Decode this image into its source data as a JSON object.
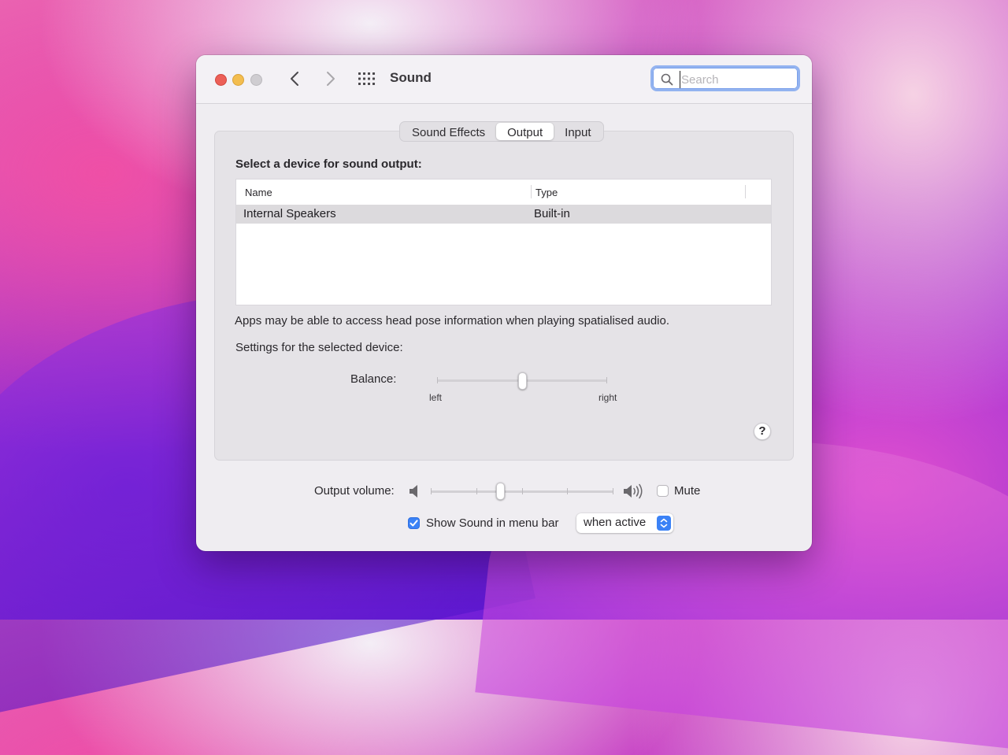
{
  "window": {
    "title": "Sound"
  },
  "search": {
    "placeholder": "Search",
    "value": ""
  },
  "tabs": [
    {
      "label": "Sound Effects",
      "active": false
    },
    {
      "label": "Output",
      "active": true
    },
    {
      "label": "Input",
      "active": false
    }
  ],
  "output": {
    "heading": "Select a device for sound output:",
    "columns": [
      "Name",
      "Type"
    ],
    "devices": [
      {
        "name": "Internal Speakers",
        "type": "Built-in",
        "selected": true
      }
    ],
    "info_text": "Apps may be able to access head pose information when playing spatialised audio.",
    "settings_label": "Settings for the selected device:",
    "balance": {
      "label": "Balance:",
      "left_label": "left",
      "right_label": "right",
      "value": 0.5
    }
  },
  "help": {
    "label": "?"
  },
  "footer": {
    "output_volume_label": "Output volume:",
    "volume_value": 0.38,
    "mute_label": "Mute",
    "mute_checked": false,
    "show_in_menubar_label": "Show Sound in menu bar",
    "show_in_menubar_checked": true,
    "menubar_option": "when active"
  },
  "colors": {
    "accent": "#3b82f6",
    "close": "#ec5f57",
    "minimize": "#f3bd4f",
    "zoom_disabled": "#cfcdd1"
  },
  "icons": [
    "back-chevron-icon",
    "forward-chevron-icon",
    "grid-icon",
    "search-icon",
    "speaker-low-icon",
    "speaker-high-icon",
    "checkmark-icon",
    "popup-updown-icon"
  ]
}
